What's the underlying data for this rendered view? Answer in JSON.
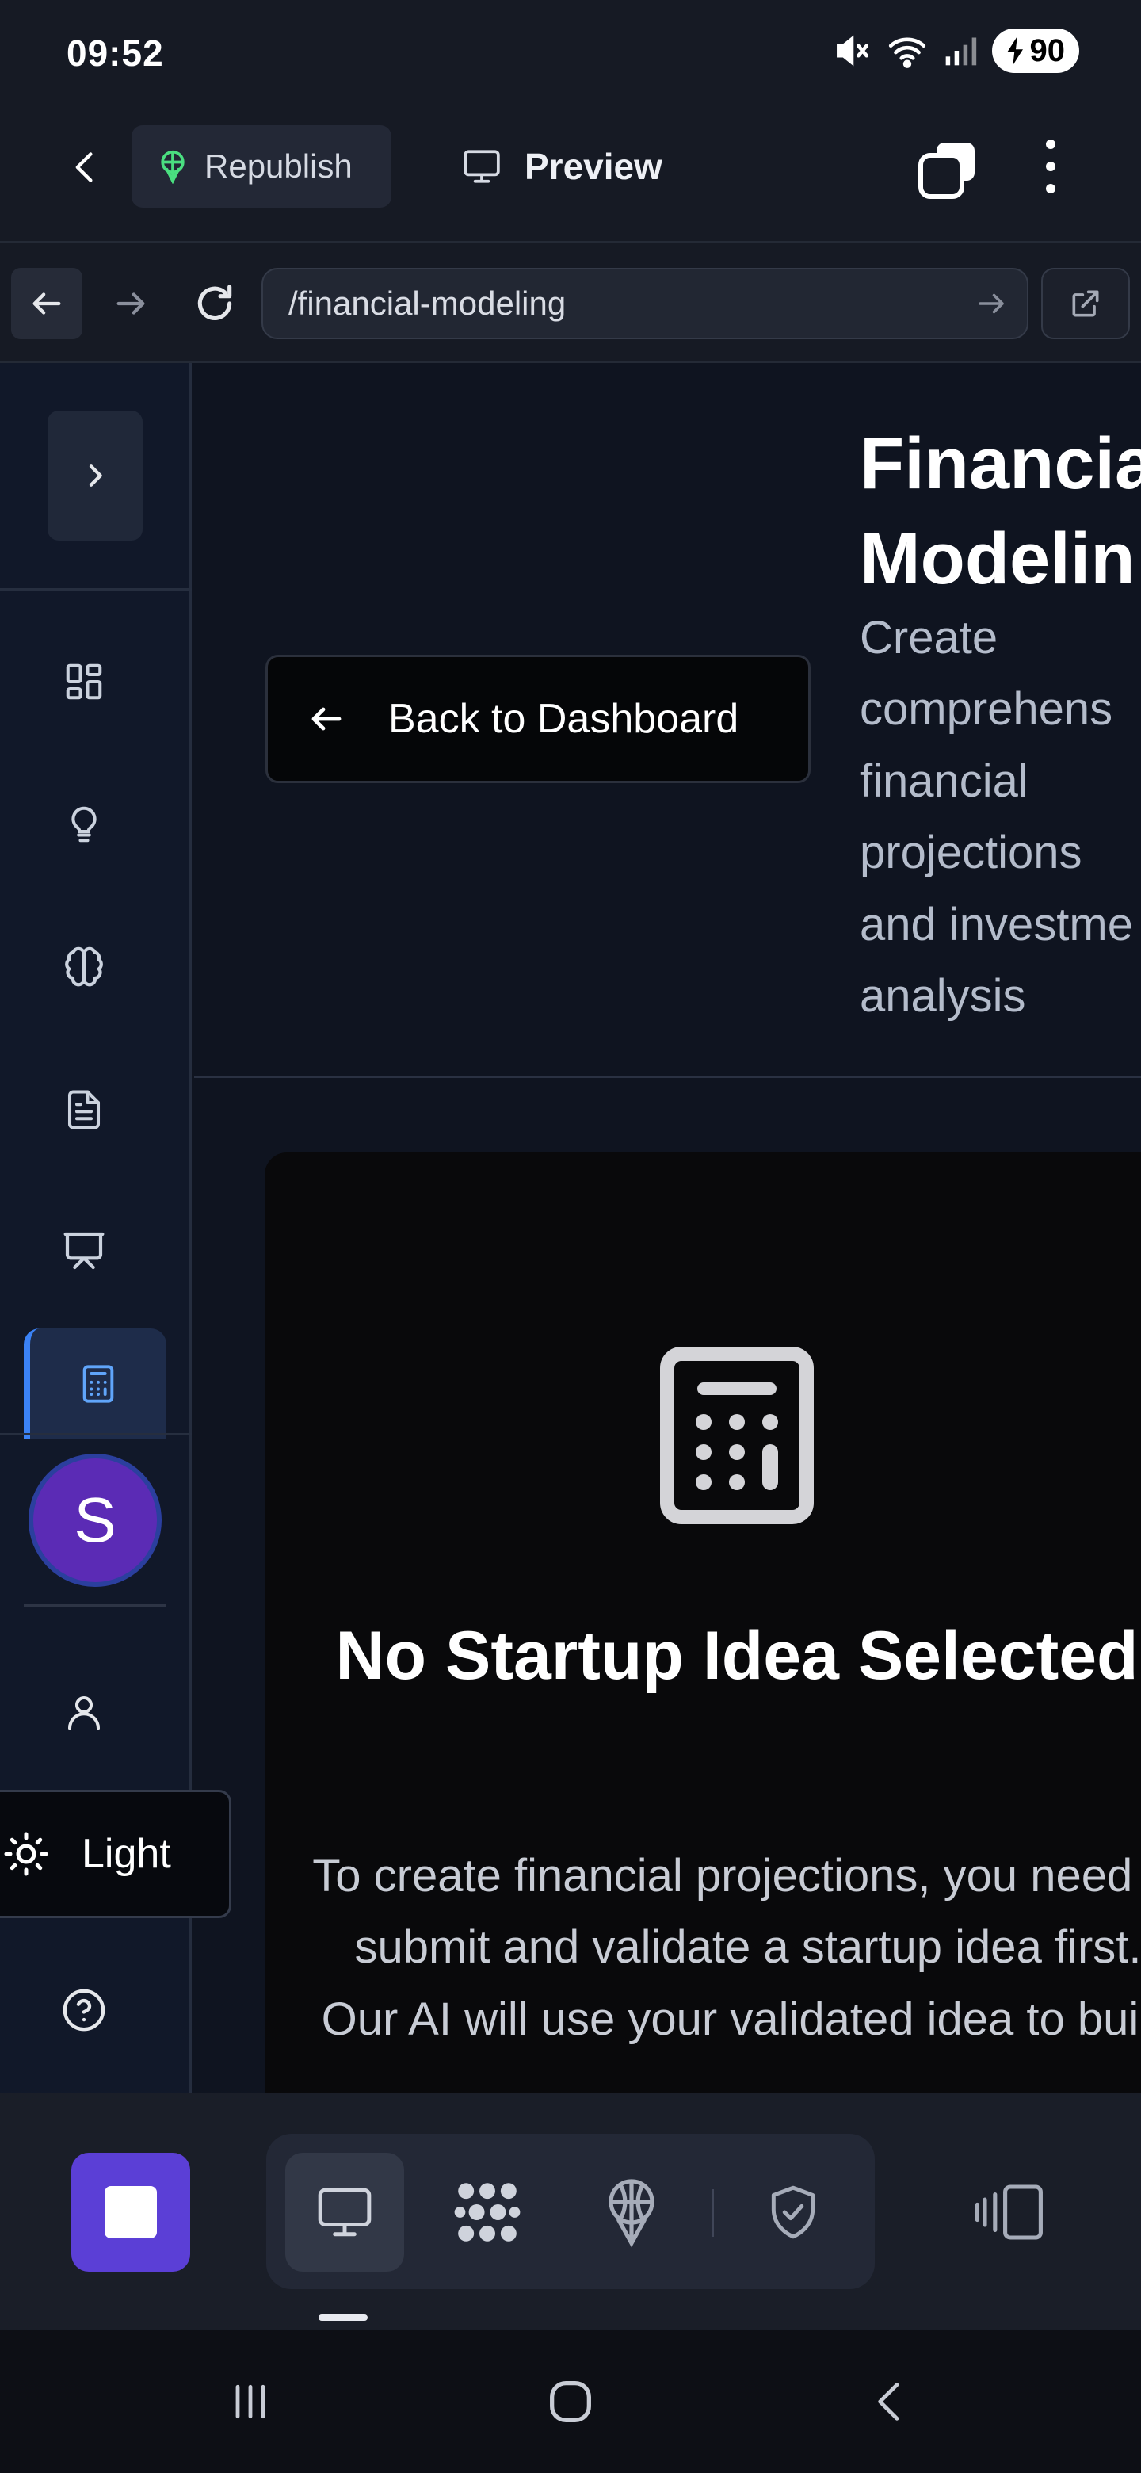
{
  "status_bar": {
    "time": "09:52",
    "battery": "90"
  },
  "app_header": {
    "republish_label": "Republish",
    "preview_label": "Preview"
  },
  "browser": {
    "url": "/financial-modeling"
  },
  "sidebar": {
    "avatar_initial": "S",
    "theme_label": "Light",
    "items": [
      {
        "icon": "dashboard-grid-icon"
      },
      {
        "icon": "lightbulb-icon"
      },
      {
        "icon": "brain-icon"
      },
      {
        "icon": "document-icon"
      },
      {
        "icon": "presentation-icon"
      },
      {
        "icon": "calculator-icon",
        "active": true
      },
      {
        "icon": "user-icon"
      },
      {
        "icon": "help-icon"
      }
    ]
  },
  "page": {
    "back_label": "Back to Dashboard",
    "title": "Financia\nModelin",
    "subtitle": "Create\ncomprehens\nfinancial\nprojections\nand investme\nanalysis"
  },
  "empty_state": {
    "icon": "calculator-icon",
    "title": "No Startup Idea Selected",
    "body": "To create financial projections, you need to submit and validate a startup idea first. Our AI will use your validated idea to build"
  },
  "bottom_toolbar": {
    "buttons": [
      "stop-icon",
      "desktop-icon",
      "workflow-icon",
      "deploy-icon",
      "shield-check-icon",
      "device-toggle-icon"
    ]
  },
  "colors": {
    "accent": "#5b3fd6",
    "active_blue": "#3b82f6",
    "avatar": "#5b2bb5",
    "republish_icon": "#4ade80"
  }
}
